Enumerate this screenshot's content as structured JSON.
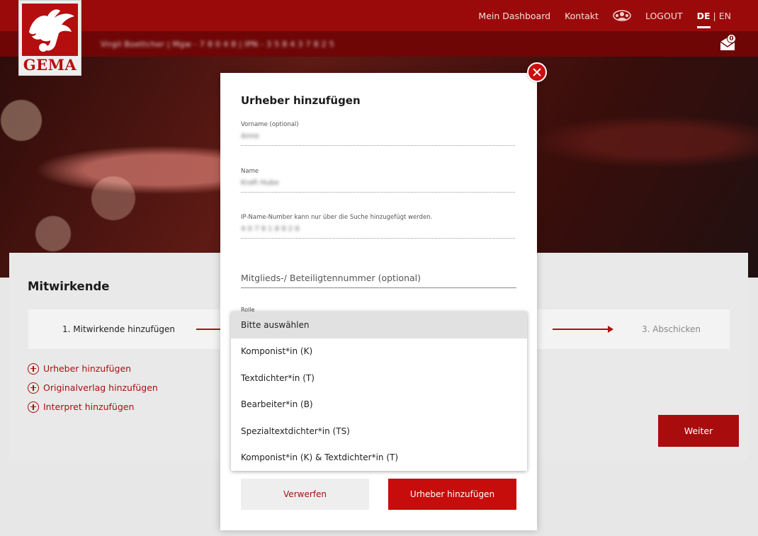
{
  "header": {
    "logo_text": "GEMA",
    "nav": {
      "dashboard": "Mein Dashboard",
      "contact": "Kontakt",
      "logout": "LOGOUT",
      "lang_de": "DE",
      "lang_sep": "|",
      "lang_en": "EN"
    },
    "user_meta": "Virgil Boettcher  |  Mgw - 7 8 0 4 8  |  IPN - 3 5 8 4 3 7 8 2 5",
    "mail_count": "0"
  },
  "page": {
    "title": "Mitwirkende",
    "steps": {
      "step1": "1. Mitwirkende hinzufügen",
      "step3": "3. Abschicken"
    },
    "add_links": [
      "Urheber hinzufügen",
      "Originalverlag hinzufügen",
      "Interpret hinzufügen"
    ],
    "next_button": "Weiter"
  },
  "modal": {
    "title": "Urheber hinzufügen",
    "fields": [
      {
        "label": "Vorname (optional)",
        "value": "Anne"
      },
      {
        "label": "Name",
        "value": "Kraft Hube"
      },
      {
        "label": "IP-Name-Number kann nur über die Suche hinzugefügt werden.",
        "value": "4 0 7 9 1 8 9 2 6"
      }
    ],
    "member_number_placeholder": "Mitglieds-/ Beteiligtennummer (optional)",
    "role_label": "Rolle",
    "role_options": [
      "Bitte auswählen",
      "Komponist*in (K)",
      "Textdichter*in (T)",
      "Bearbeiter*in (B)",
      "Spezialtextdichter*in (TS)",
      "Komponist*in (K) & Textdichter*in (T)"
    ],
    "selected_option_index": 0,
    "cancel_button": "Verwerfen",
    "submit_button": "Urheber hinzufügen"
  },
  "colors": {
    "brand_red": "#9b0a0a",
    "dark_red": "#6e0606",
    "button_red": "#c70c0c",
    "link_red": "#a80f0f"
  }
}
